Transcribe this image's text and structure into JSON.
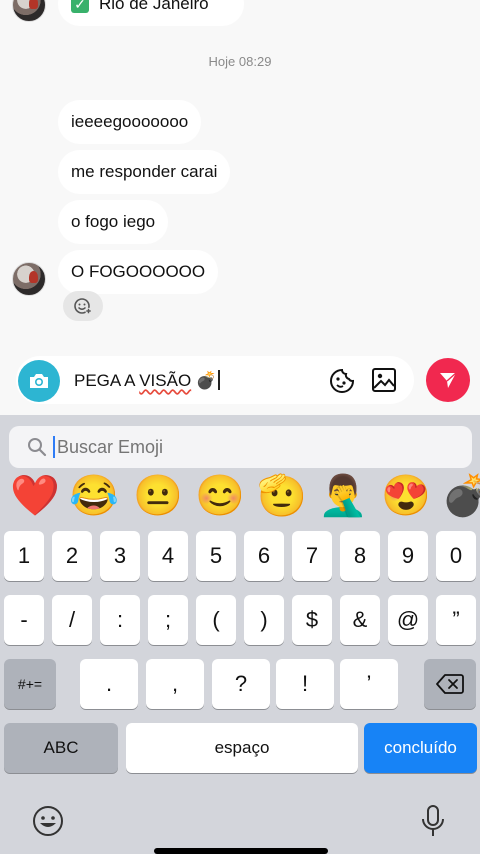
{
  "chat": {
    "top_bubble_text": "Rio de Janeiro",
    "timestamp": "Hoje 08:29",
    "messages": [
      {
        "text": "ieeeegooooooo"
      },
      {
        "text": "me responder carai"
      },
      {
        "text": "o fogo iego"
      },
      {
        "text": "O FOGOOOOOO"
      }
    ]
  },
  "composer": {
    "text_before": "PEGA A ",
    "text_misspelled": "VISÃO",
    "text_after": " 💣"
  },
  "keyboard": {
    "search_placeholder": "Buscar Emoji",
    "emojis": [
      "❤️",
      "😂",
      "😐",
      "😊",
      "🫡",
      "🤦‍♂️",
      "😍",
      "💣"
    ],
    "row1": [
      "1",
      "2",
      "3",
      "4",
      "5",
      "6",
      "7",
      "8",
      "9",
      "0"
    ],
    "row2": [
      "-",
      "/",
      ":",
      ";",
      "(",
      ")",
      "$",
      "&",
      "@",
      "”"
    ],
    "row3": [
      "#+=",
      ".",
      ",",
      "?",
      "!",
      "’"
    ],
    "abc_label": "ABC",
    "space_label": "espaço",
    "done_label": "concluído"
  },
  "colors": {
    "camera": "#2db5d2",
    "send": "#f1284f",
    "done": "#1783f6"
  }
}
